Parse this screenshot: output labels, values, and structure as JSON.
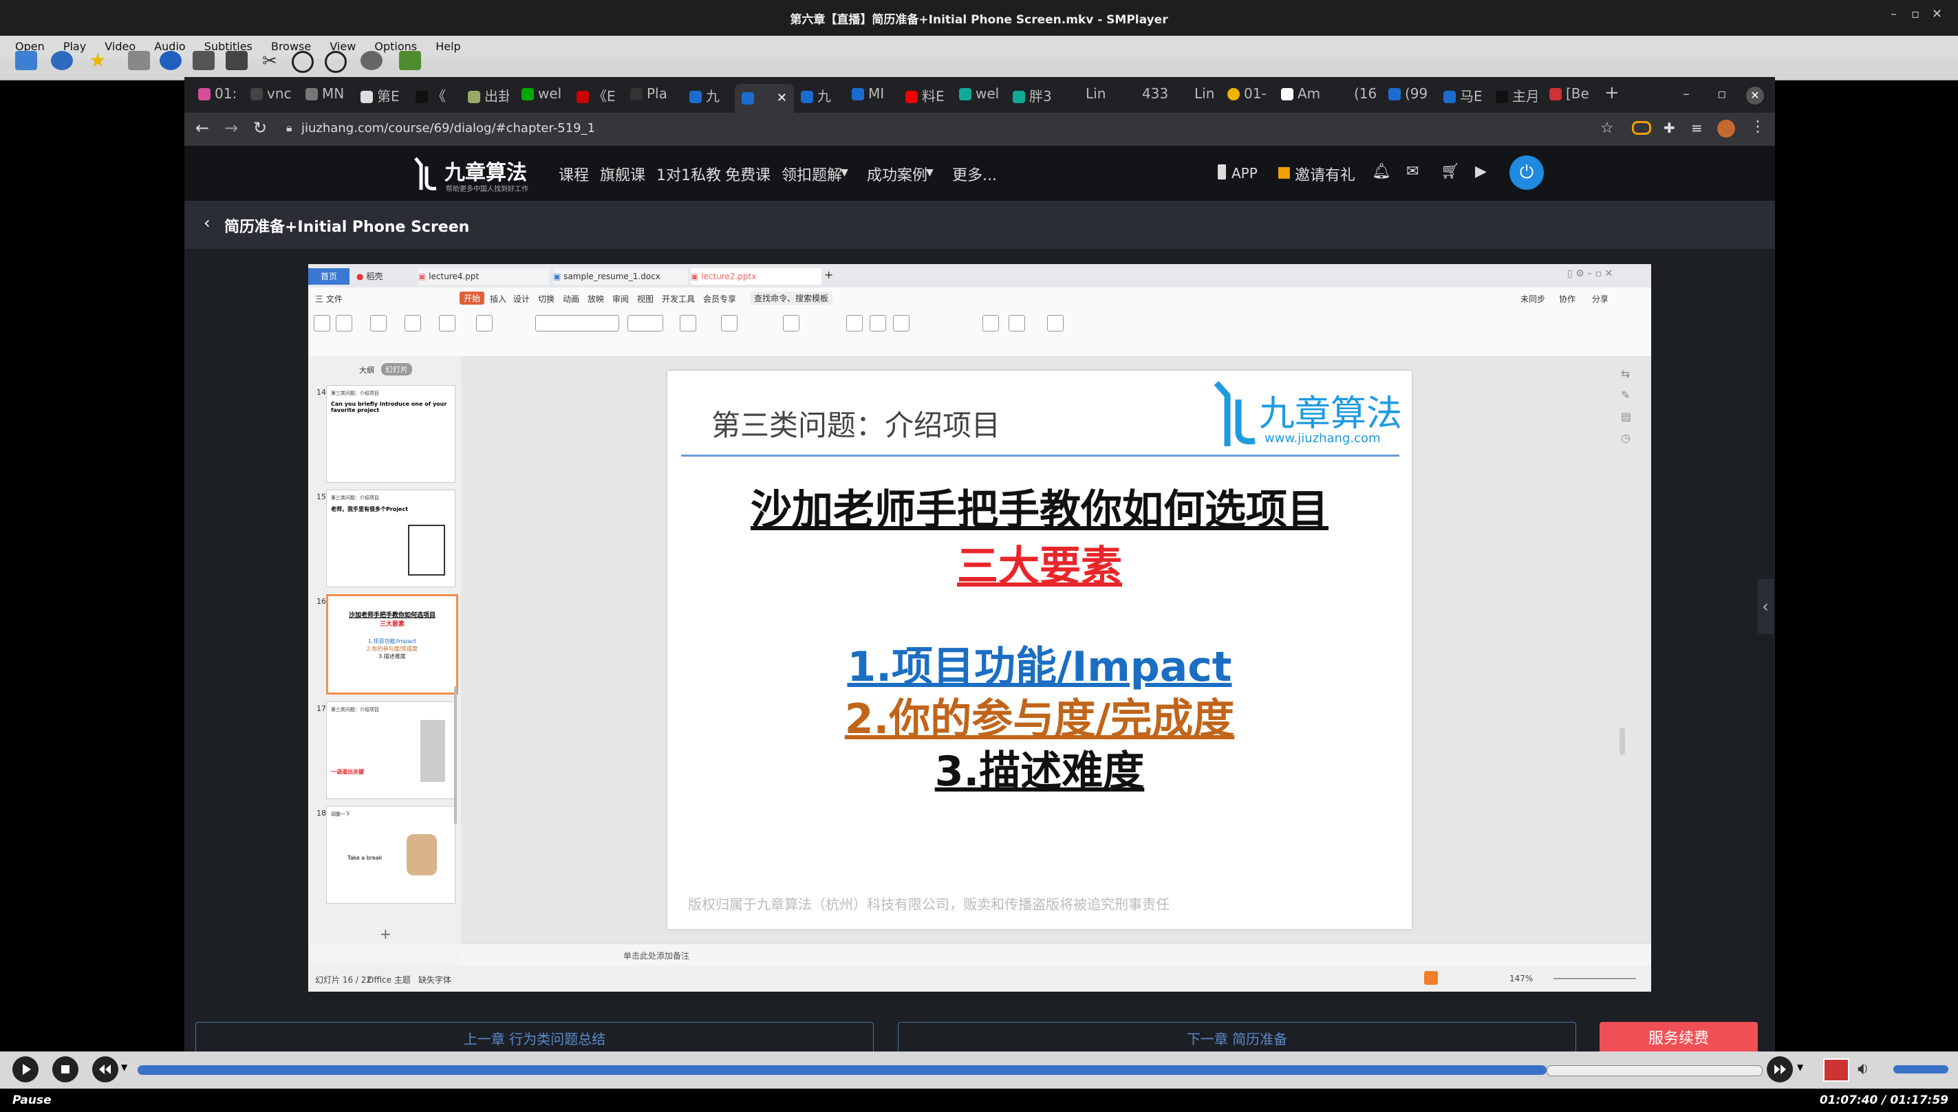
{
  "window": {
    "title": "第六章【直播】简历准备+Initial Phone Screen.mkv - SMPlayer"
  },
  "menubar": [
    "Open",
    "Play",
    "Video",
    "Audio",
    "Subtitles",
    "Browse",
    "View",
    "Options",
    "Help"
  ],
  "browser": {
    "tabs": [
      "01:",
      "vnc",
      "MN",
      "第E",
      "《",
      "出卦",
      "wel",
      "《E",
      "Pla",
      "九",
      "九",
      "MI",
      "料E",
      "wel",
      "胖3",
      "Lin",
      "433",
      "Lin",
      "01-",
      "Am",
      "(16",
      "(99",
      "马E",
      "主月",
      "[Be"
    ],
    "url": "jiuzhang.com/course/69/dialog/#chapter-519_1"
  },
  "site": {
    "logo_text": "九章算法",
    "logo_sub": "帮助更多中国人找到好工作",
    "nav": [
      "课程",
      "旗舰课",
      "1对1私教",
      "免费课",
      "领扣题解",
      "成功案例",
      "更多..."
    ],
    "app_label": "APP",
    "invite_label": "邀请有礼",
    "chapter_title": "简历准备+Initial Phone Screen"
  },
  "ppt": {
    "tabs": [
      "首页",
      "稻壳",
      "lecture4.ppt",
      "sample_resume_1.docx",
      "lecture2.pptx"
    ],
    "menu": [
      "三 文件",
      "开始",
      "插入",
      "设计",
      "切换",
      "动画",
      "放映",
      "审阅",
      "视图",
      "开发工具",
      "会员专享",
      "查找命令、搜索模板"
    ],
    "right_menu": [
      "未同步",
      "协作",
      "分享"
    ],
    "view_tabs": [
      "大纲",
      "幻灯片"
    ],
    "thumbs": [
      {
        "num": "14",
        "title": "第三类问题：介绍项目",
        "line": "Can you briefly introduce one of your favorite project"
      },
      {
        "num": "15",
        "title": "第三类问题：介绍项目",
        "line": "老师，我手里有很多个Project"
      },
      {
        "num": "16",
        "title": "沙加老师手把手教你如何选项目",
        "line": "三大要素"
      },
      {
        "num": "17",
        "title": "第三类问题：介绍项目",
        "line": "一语道出关键"
      },
      {
        "num": "18",
        "title": "调整一下",
        "line": "Take a break"
      }
    ],
    "notes_placeholder": "单击此处添加备注",
    "status_left": "幻灯片 16 / 22",
    "status_theme": "Office 主题",
    "status_font": "缺失字体",
    "zoom": "147%",
    "slide": {
      "header": "第三类问题：介绍项目",
      "logo_name": "九章算法",
      "logo_url": "www.jiuzhang.com",
      "title": "沙加老师手把手教你如何选项目",
      "subtitle": "三大要素",
      "item1": "1.项目功能/Impact",
      "item2": "2.你的参与度/完成度",
      "item3": "3.描述难度",
      "footer": "版权归属于九章算法（杭州）科技有限公司，贩卖和传播盗版将被追究刑事责任"
    }
  },
  "footer": {
    "prev": "上一章 行为类问题总结",
    "next": "下一章 简历准备",
    "renew": "服务续费"
  },
  "player": {
    "state": "Pause",
    "time": "01:07:40 / 01:17:59",
    "progress": 0.868
  },
  "colors": {
    "accent_red": "#e8262a",
    "blue": "#1b6ec2",
    "orange": "#c0651a",
    "renew_bg": "#f05055"
  }
}
